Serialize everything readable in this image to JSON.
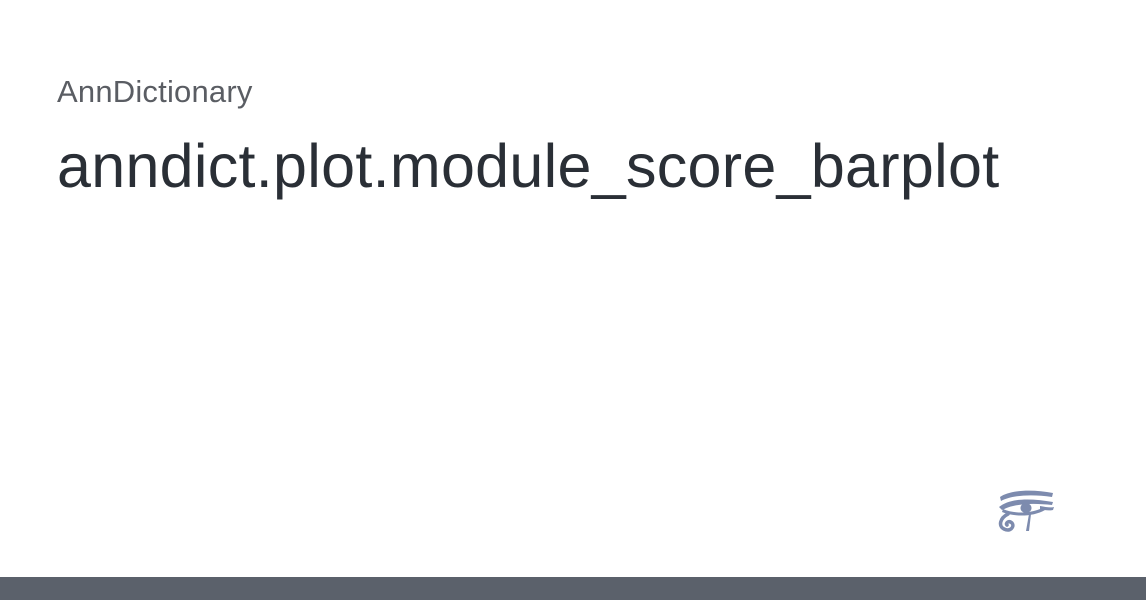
{
  "header": {
    "site_name": "AnnDictionary",
    "page_title": "anndict.plot.module_score_barplot"
  },
  "logo": {
    "icon": "eye-of-horus-icon",
    "color": "#7d8bae"
  },
  "footer_bar": {
    "color": "#5b616b"
  }
}
